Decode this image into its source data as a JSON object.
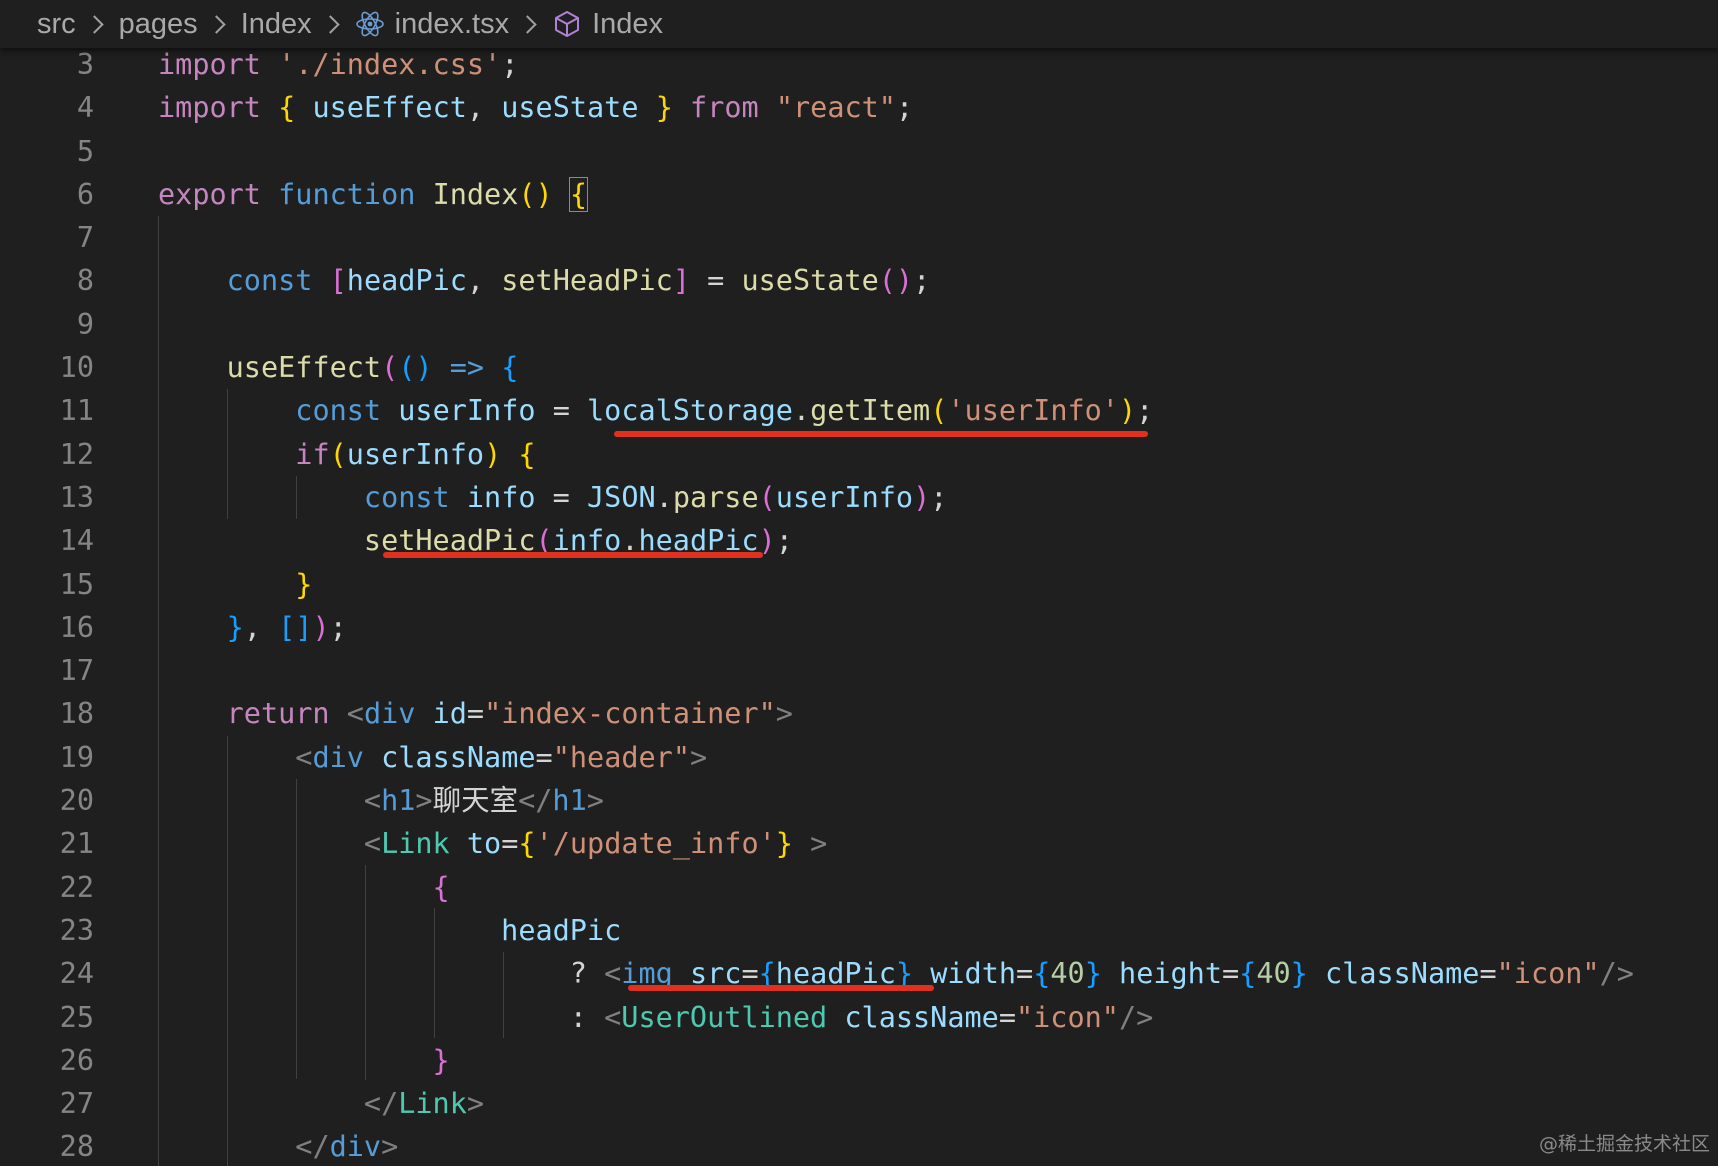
{
  "breadcrumb": {
    "items": [
      "src",
      "pages",
      "Index",
      "index.tsx",
      "Index"
    ]
  },
  "editor": {
    "lines": [
      {
        "n": "3",
        "tokens": [
          [
            "kw",
            "import"
          ],
          [
            "pn",
            " "
          ],
          [
            "st",
            "'./index.css'"
          ],
          [
            "pn",
            ";"
          ]
        ]
      },
      {
        "n": "4",
        "tokens": [
          [
            "kw",
            "import"
          ],
          [
            "pn",
            " "
          ],
          [
            "b1",
            "{"
          ],
          [
            "pn",
            " "
          ],
          [
            "vr",
            "useEffect"
          ],
          [
            "pn",
            ", "
          ],
          [
            "vr",
            "useState"
          ],
          [
            "pn",
            " "
          ],
          [
            "b1",
            "}"
          ],
          [
            "pn",
            " "
          ],
          [
            "kw",
            "from"
          ],
          [
            "pn",
            " "
          ],
          [
            "st",
            "\"react\""
          ],
          [
            "pn",
            ";"
          ]
        ]
      },
      {
        "n": "5",
        "tokens": []
      },
      {
        "n": "6",
        "tokens": [
          [
            "kw",
            "export"
          ],
          [
            "pn",
            " "
          ],
          [
            "st2",
            "function"
          ],
          [
            "pn",
            " "
          ],
          [
            "fn",
            "Index"
          ],
          [
            "b1",
            "()"
          ],
          [
            "pn",
            " "
          ],
          [
            "b1",
            "{",
            "box"
          ]
        ]
      },
      {
        "n": "7",
        "tokens": []
      },
      {
        "n": "8",
        "tokens": [
          [
            "pn",
            "    "
          ],
          [
            "st2",
            "const"
          ],
          [
            "pn",
            " "
          ],
          [
            "b2",
            "["
          ],
          [
            "vr",
            "headPic"
          ],
          [
            "pn",
            ", "
          ],
          [
            "fn",
            "setHeadPic"
          ],
          [
            "b2",
            "]"
          ],
          [
            "pn",
            " = "
          ],
          [
            "fn",
            "useState"
          ],
          [
            "b2",
            "()"
          ],
          [
            "pn",
            ";"
          ]
        ]
      },
      {
        "n": "9",
        "tokens": []
      },
      {
        "n": "10",
        "tokens": [
          [
            "pn",
            "    "
          ],
          [
            "fn",
            "useEffect"
          ],
          [
            "b2",
            "("
          ],
          [
            "b3",
            "()"
          ],
          [
            "pn",
            " "
          ],
          [
            "st2",
            "=>"
          ],
          [
            "pn",
            " "
          ],
          [
            "b3",
            "{"
          ]
        ]
      },
      {
        "n": "11",
        "tokens": [
          [
            "pn",
            "        "
          ],
          [
            "st2",
            "const"
          ],
          [
            "pn",
            " "
          ],
          [
            "vr",
            "userInfo"
          ],
          [
            "pn",
            " = "
          ],
          [
            "vr",
            "localStorage"
          ],
          [
            "pn",
            "."
          ],
          [
            "fn",
            "getItem"
          ],
          [
            "b1",
            "("
          ],
          [
            "st",
            "'userInfo'"
          ],
          [
            "b1",
            ")"
          ],
          [
            "pn",
            ";"
          ]
        ]
      },
      {
        "n": "12",
        "tokens": [
          [
            "pn",
            "        "
          ],
          [
            "kw",
            "if"
          ],
          [
            "b1",
            "("
          ],
          [
            "vr",
            "userInfo"
          ],
          [
            "b1",
            ")"
          ],
          [
            "pn",
            " "
          ],
          [
            "b1",
            "{"
          ]
        ]
      },
      {
        "n": "13",
        "tokens": [
          [
            "pn",
            "            "
          ],
          [
            "st2",
            "const"
          ],
          [
            "pn",
            " "
          ],
          [
            "vr",
            "info"
          ],
          [
            "pn",
            " = "
          ],
          [
            "vr",
            "JSON"
          ],
          [
            "pn",
            "."
          ],
          [
            "fn",
            "parse"
          ],
          [
            "b2",
            "("
          ],
          [
            "vr",
            "userInfo"
          ],
          [
            "b2",
            ")"
          ],
          [
            "pn",
            ";"
          ]
        ]
      },
      {
        "n": "14",
        "tokens": [
          [
            "pn",
            "            "
          ],
          [
            "fn",
            "setHeadPic"
          ],
          [
            "b2",
            "("
          ],
          [
            "vr",
            "info"
          ],
          [
            "pn",
            "."
          ],
          [
            "vr",
            "headPic"
          ],
          [
            "b2",
            ")"
          ],
          [
            "pn",
            ";"
          ]
        ]
      },
      {
        "n": "15",
        "tokens": [
          [
            "pn",
            "        "
          ],
          [
            "b1",
            "}"
          ]
        ]
      },
      {
        "n": "16",
        "tokens": [
          [
            "pn",
            "    "
          ],
          [
            "b3",
            "}"
          ],
          [
            "pn",
            ", "
          ],
          [
            "b3",
            "[]"
          ],
          [
            "b2",
            ")"
          ],
          [
            "pn",
            ";"
          ]
        ]
      },
      {
        "n": "17",
        "tokens": []
      },
      {
        "n": "18",
        "tokens": [
          [
            "pn",
            "    "
          ],
          [
            "kw",
            "return"
          ],
          [
            "pn",
            " "
          ],
          [
            "ang",
            "<"
          ],
          [
            "tg",
            "div"
          ],
          [
            "pn",
            " "
          ],
          [
            "vr",
            "id"
          ],
          [
            "pn",
            "="
          ],
          [
            "st",
            "\"index-container\""
          ],
          [
            "ang",
            ">"
          ]
        ]
      },
      {
        "n": "19",
        "tokens": [
          [
            "pn",
            "        "
          ],
          [
            "ang",
            "<"
          ],
          [
            "tg",
            "div"
          ],
          [
            "pn",
            " "
          ],
          [
            "vr",
            "className"
          ],
          [
            "pn",
            "="
          ],
          [
            "st",
            "\"header\""
          ],
          [
            "ang",
            ">"
          ]
        ]
      },
      {
        "n": "20",
        "tokens": [
          [
            "pn",
            "            "
          ],
          [
            "ang",
            "<"
          ],
          [
            "tg",
            "h1"
          ],
          [
            "ang",
            ">"
          ],
          [
            "pn",
            "聊天室"
          ],
          [
            "ang",
            "</"
          ],
          [
            "tg",
            "h1"
          ],
          [
            "ang",
            ">"
          ]
        ]
      },
      {
        "n": "21",
        "tokens": [
          [
            "pn",
            "            "
          ],
          [
            "ang",
            "<"
          ],
          [
            "cm",
            "Link"
          ],
          [
            "pn",
            " "
          ],
          [
            "vr",
            "to"
          ],
          [
            "pn",
            "="
          ],
          [
            "b1",
            "{"
          ],
          [
            "st",
            "'/update_info'"
          ],
          [
            "b1",
            "}"
          ],
          [
            "pn",
            " "
          ],
          [
            "ang",
            ">"
          ]
        ]
      },
      {
        "n": "22",
        "tokens": [
          [
            "pn",
            "                "
          ],
          [
            "b2",
            "{"
          ]
        ]
      },
      {
        "n": "23",
        "tokens": [
          [
            "pn",
            "                    "
          ],
          [
            "vr",
            "headPic"
          ]
        ]
      },
      {
        "n": "24",
        "tokens": [
          [
            "pn",
            "                        ? "
          ],
          [
            "ang",
            "<"
          ],
          [
            "tg",
            "img"
          ],
          [
            "pn",
            " "
          ],
          [
            "vr",
            "src"
          ],
          [
            "pn",
            "="
          ],
          [
            "b3",
            "{"
          ],
          [
            "vr",
            "headPic"
          ],
          [
            "b3",
            "}"
          ],
          [
            "pn",
            " "
          ],
          [
            "vr",
            "width"
          ],
          [
            "pn",
            "="
          ],
          [
            "b3",
            "{"
          ],
          [
            "nm",
            "40"
          ],
          [
            "b3",
            "}"
          ],
          [
            "pn",
            " "
          ],
          [
            "vr",
            "height"
          ],
          [
            "pn",
            "="
          ],
          [
            "b3",
            "{"
          ],
          [
            "nm",
            "40"
          ],
          [
            "b3",
            "}"
          ],
          [
            "pn",
            " "
          ],
          [
            "vr",
            "className"
          ],
          [
            "pn",
            "="
          ],
          [
            "st",
            "\"icon\""
          ],
          [
            "ang",
            "/>"
          ]
        ]
      },
      {
        "n": "25",
        "tokens": [
          [
            "pn",
            "                        : "
          ],
          [
            "ang",
            "<"
          ],
          [
            "cm",
            "UserOutlined"
          ],
          [
            "pn",
            " "
          ],
          [
            "vr",
            "className"
          ],
          [
            "pn",
            "="
          ],
          [
            "st",
            "\"icon\""
          ],
          [
            "ang",
            "/>"
          ]
        ]
      },
      {
        "n": "26",
        "tokens": [
          [
            "pn",
            "                "
          ],
          [
            "b2",
            "}"
          ]
        ]
      },
      {
        "n": "27",
        "tokens": [
          [
            "pn",
            "            "
          ],
          [
            "ang",
            "</"
          ],
          [
            "cm",
            "Link"
          ],
          [
            "ang",
            ">"
          ]
        ]
      },
      {
        "n": "28",
        "tokens": [
          [
            "pn",
            "        "
          ],
          [
            "ang",
            "</"
          ],
          [
            "tg",
            "div"
          ],
          [
            "ang",
            ">"
          ]
        ]
      }
    ]
  },
  "watermark": "@稀土掘金技术社区"
}
